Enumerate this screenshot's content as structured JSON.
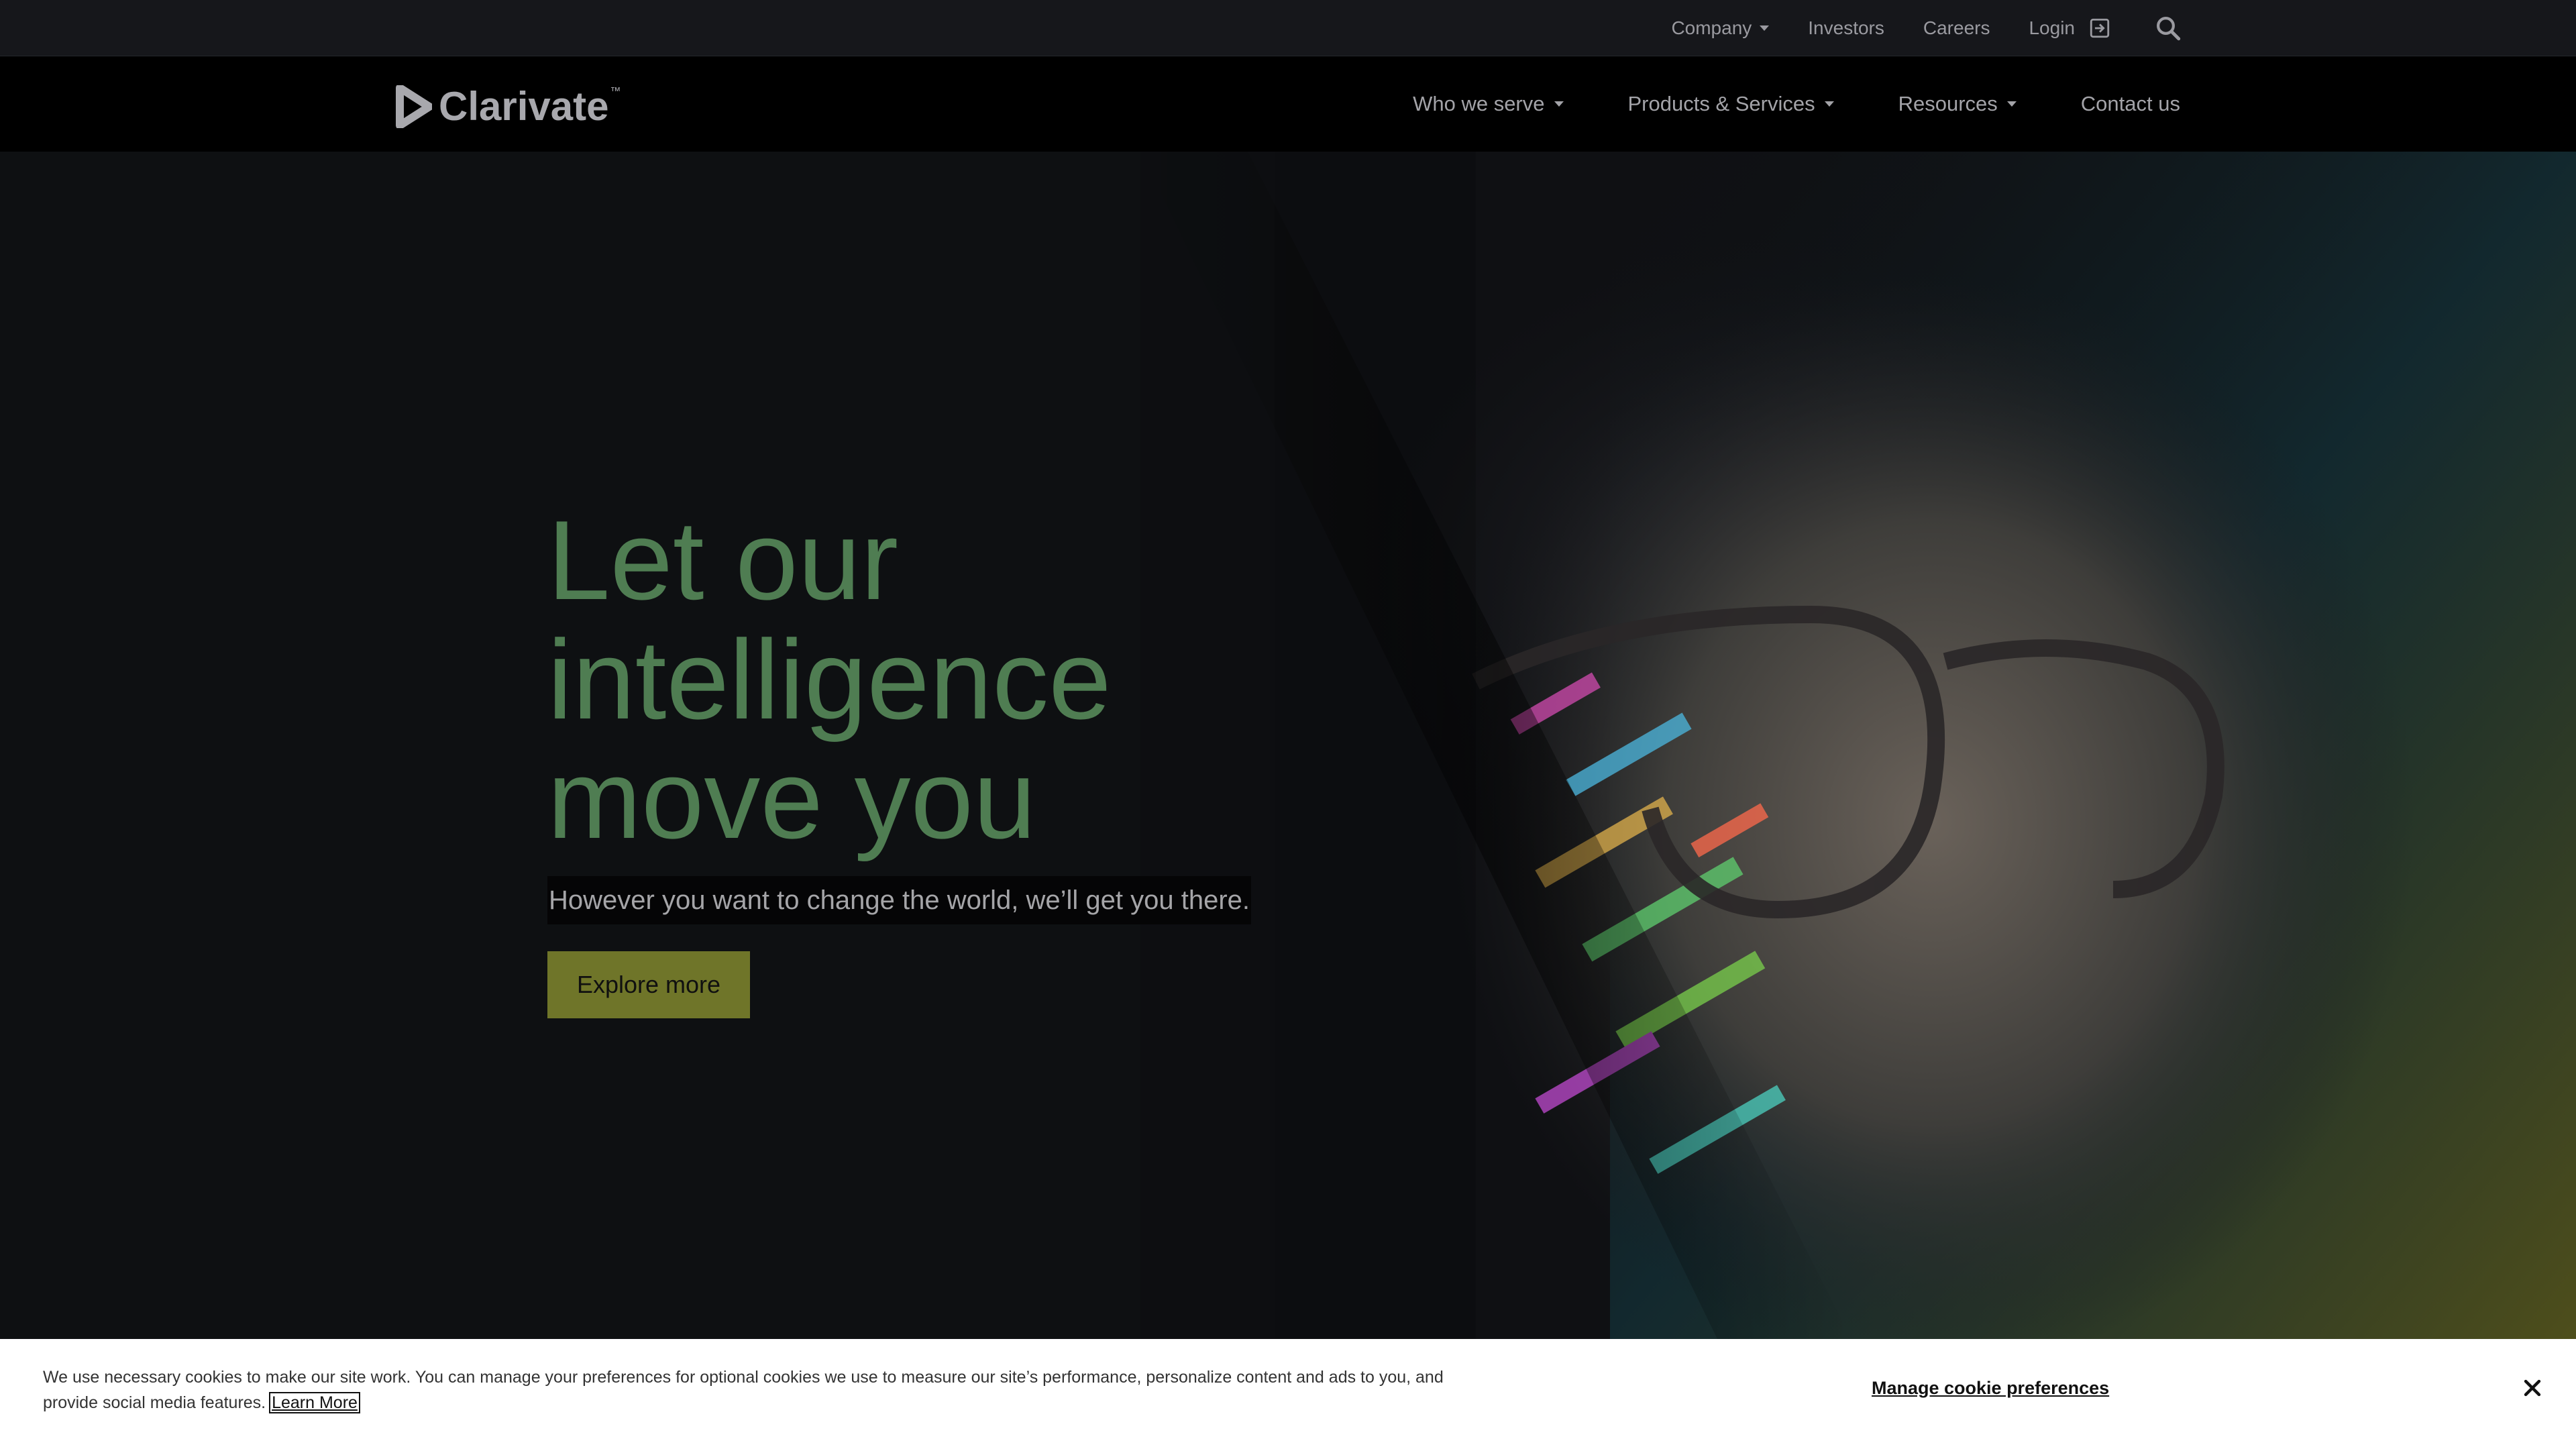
{
  "utility_bar": {
    "company_label": "Company",
    "investors_label": "Investors",
    "careers_label": "Careers",
    "login_label": "Login"
  },
  "logo": {
    "text": "Clarivate",
    "tm": "™"
  },
  "main_nav": {
    "items": [
      {
        "label": "Who we serve"
      },
      {
        "label": "Products & Services"
      },
      {
        "label": "Resources"
      },
      {
        "label": "Contact us"
      }
    ]
  },
  "hero": {
    "title_lines": [
      "Let our",
      "intelligence",
      "move you"
    ],
    "subtitle": "However you want to change the world, we’ll get you there.",
    "cta_label": "Explore more"
  },
  "cookie_banner": {
    "text_line1": "We use necessary cookies to make our site work. You can manage your preferences for optional cookies we use to measure our site’s performance, personalize content and ads to you, and",
    "text_line2": "provide social media features.",
    "learn_more": "Learn More",
    "manage_label": "Manage cookie preferences"
  },
  "colors": {
    "accent_green": "#4f7d52",
    "cta_olive": "#6f7529",
    "nav_bg": "#000000",
    "utility_bg": "#16171b"
  },
  "icons": [
    "chevron-down-icon",
    "login-icon",
    "search-icon",
    "clarivate-logo-icon",
    "close-icon"
  ]
}
